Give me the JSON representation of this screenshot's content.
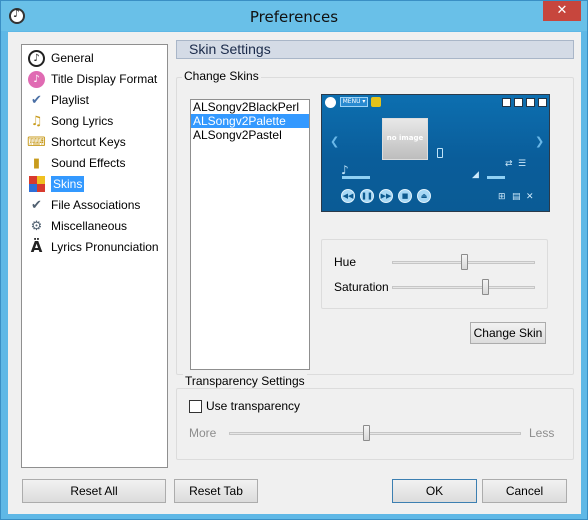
{
  "window": {
    "title": "Preferences",
    "close_glyph": "✕"
  },
  "sidebar": {
    "items": [
      {
        "label": "General",
        "icon": "disc-icon",
        "glyph": "♪"
      },
      {
        "label": "Title Display Format",
        "icon": "title-format-icon",
        "glyph": "♪"
      },
      {
        "label": "Playlist",
        "icon": "playlist-icon",
        "glyph": "✔"
      },
      {
        "label": "Song Lyrics",
        "icon": "lyrics-icon",
        "glyph": "♫"
      },
      {
        "label": "Shortcut Keys",
        "icon": "keyboard-icon",
        "glyph": "⌨"
      },
      {
        "label": "Sound Effects",
        "icon": "speaker-icon",
        "glyph": "▮"
      },
      {
        "label": "Skins",
        "icon": "skins-icon",
        "glyph": ""
      },
      {
        "label": "File Associations",
        "icon": "folder-icon",
        "glyph": "✔"
      },
      {
        "label": "Miscellaneous",
        "icon": "wrench-icon",
        "glyph": "⚙"
      },
      {
        "label": "Lyrics Pronunciation",
        "icon": "umlaut-a-icon",
        "glyph": "Ä"
      }
    ],
    "selected": "Skins"
  },
  "skin_settings": {
    "section_title": "Skin Settings",
    "change_skins_label": "Change Skins",
    "skins": [
      "ALSongv2BlackPerl",
      "ALSongv2Palette",
      "ALSongv2Pastel"
    ],
    "selected_skin": "ALSongv2Palette",
    "preview": {
      "menu_label": "MENU ▾",
      "art_text": "no image"
    },
    "hue_label": "Hue",
    "hue_value": 0.5,
    "saturation_label": "Saturation",
    "saturation_value": 0.65,
    "change_skin_button": "Change Skin"
  },
  "transparency": {
    "group_label": "Transparency Settings",
    "use_transparency_label": "Use transparency",
    "use_transparency_checked": false,
    "more_label": "More",
    "less_label": "Less",
    "level": 0.47
  },
  "footer": {
    "reset_all": "Reset All",
    "reset_tab": "Reset Tab",
    "ok": "OK",
    "cancel": "Cancel"
  },
  "colors": {
    "titlebar": "#69c0e8",
    "selection": "#3399ff",
    "close": "#c7463d"
  }
}
